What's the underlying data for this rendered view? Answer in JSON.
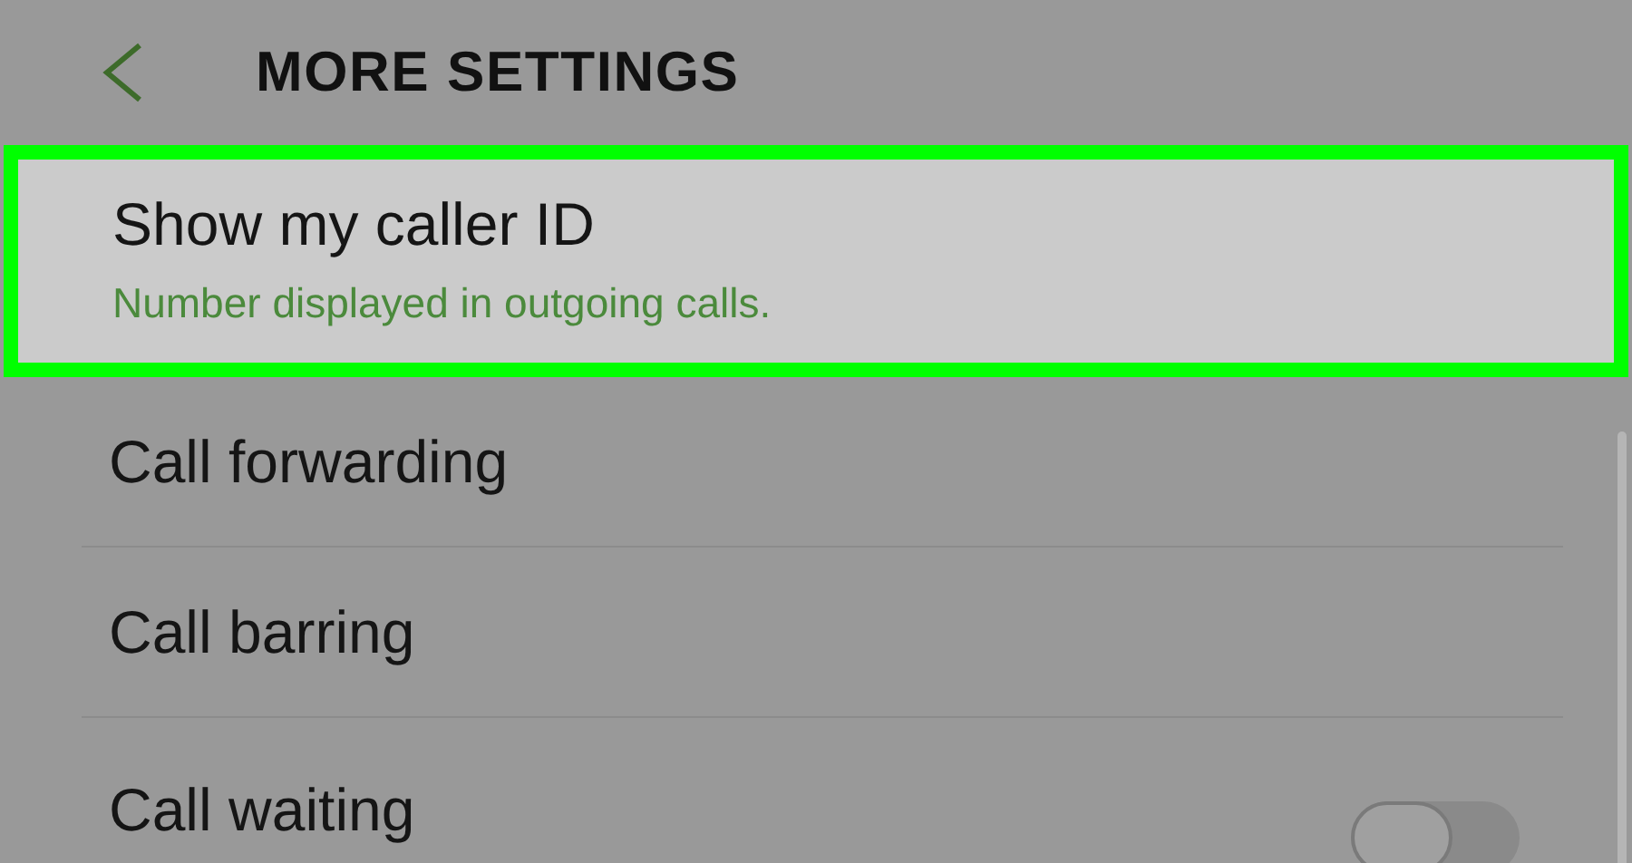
{
  "header": {
    "title": "MORE SETTINGS"
  },
  "items": [
    {
      "kind": "plain",
      "title": "Show my caller ID",
      "subtitle": "Number displayed in outgoing calls.",
      "selected": true
    },
    {
      "kind": "plain",
      "title": "Call forwarding",
      "selected": false
    },
    {
      "kind": "plain",
      "title": "Call barring",
      "selected": false
    },
    {
      "kind": "toggle",
      "title": "Call waiting",
      "on": false,
      "selected": false
    }
  ]
}
